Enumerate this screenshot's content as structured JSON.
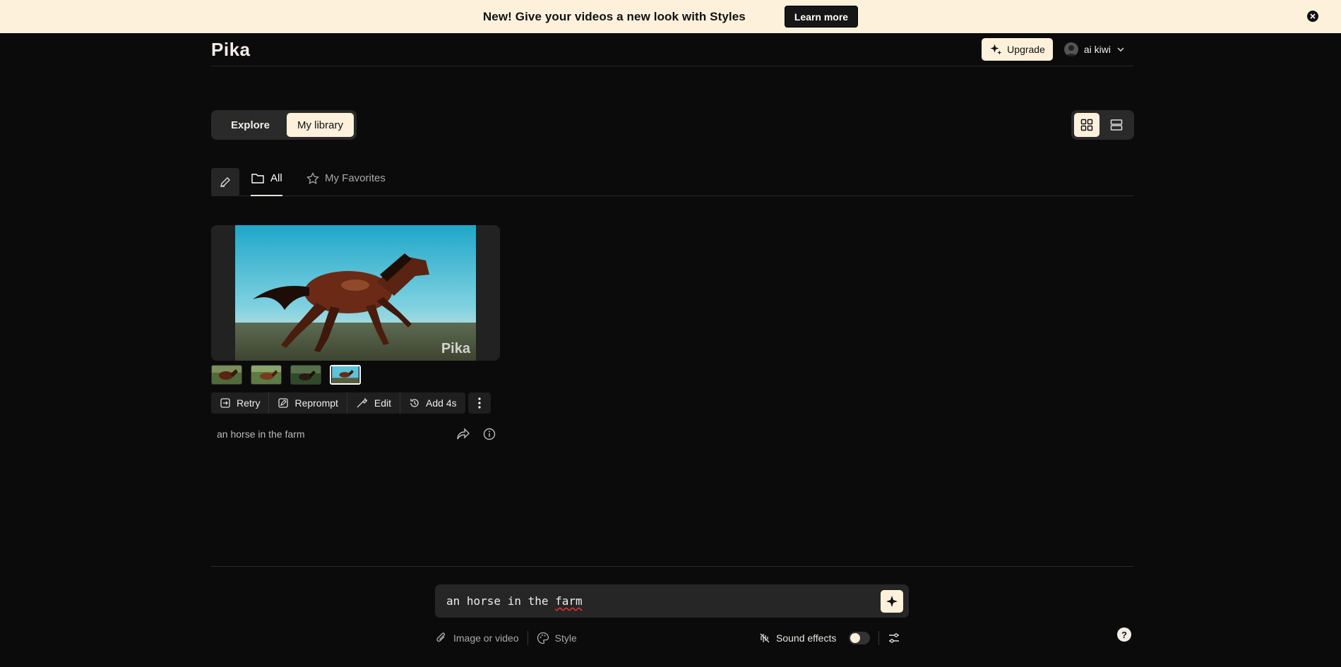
{
  "banner": {
    "text": "New! Give your videos a new look with Styles",
    "button_label": "Learn more"
  },
  "header": {
    "logo": "Pika",
    "upgrade_label": "Upgrade",
    "user_name": "ai kiwi"
  },
  "library_toggle": {
    "explore_label": "Explore",
    "library_label": "My library",
    "selected": "My library"
  },
  "tabs": {
    "all_label": "All",
    "favorites_label": "My Favorites",
    "selected": "All"
  },
  "card": {
    "watermark": "Pika",
    "thumbnail_count": 4,
    "selected_thumbnail": 4,
    "actions": {
      "retry": "Retry",
      "reprompt": "Reprompt",
      "edit": "Edit",
      "add": "Add 4s"
    },
    "prompt": "an horse in the farm"
  },
  "composer": {
    "input_value_a": "an horse in the ",
    "input_value_b": "farm",
    "image_or_video_label": "Image or video",
    "style_label": "Style",
    "sound_effects_label": "Sound effects",
    "sound_effects_on": false
  },
  "help_label": "?",
  "colors": {
    "background": "#0b0b0b",
    "accent": "#fdf1dc",
    "panel": "#2a2a2a"
  }
}
